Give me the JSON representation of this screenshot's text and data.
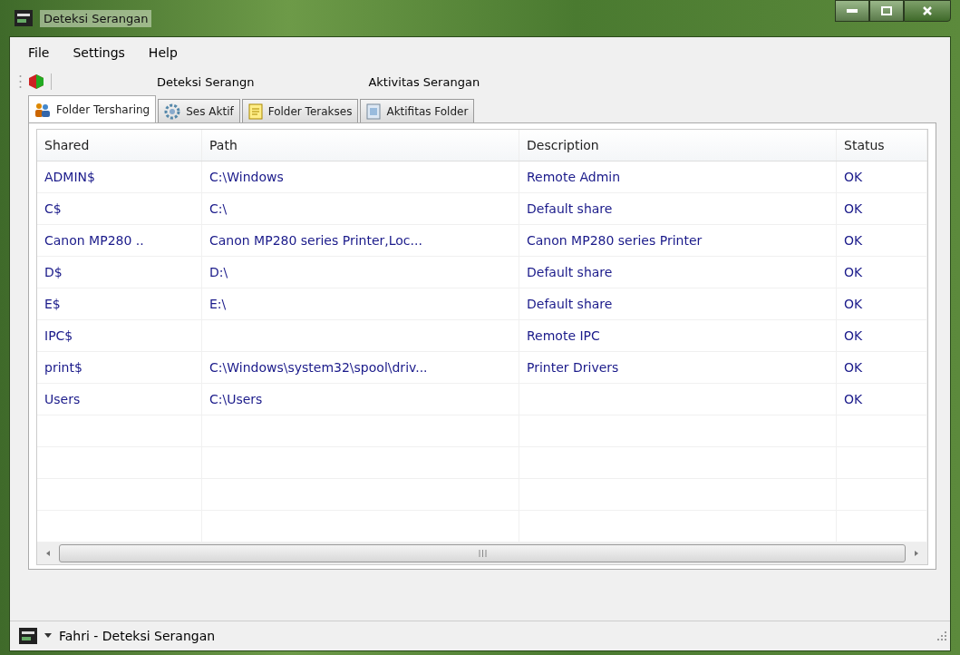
{
  "window": {
    "title": "Deteksi Serangan"
  },
  "menu": [
    "File",
    "Settings",
    "Help"
  ],
  "toolbar": {
    "items": [
      "Deteksi Serangn",
      "Aktivitas Serangan"
    ]
  },
  "tabs": [
    {
      "label": "Folder Tersharing",
      "selected": true
    },
    {
      "label": "Ses Aktif",
      "selected": false
    },
    {
      "label": "Folder Terakses",
      "selected": false
    },
    {
      "label": "Aktifitas Folder",
      "selected": false
    }
  ],
  "table": {
    "columns": [
      "Shared",
      "Path",
      "Description",
      "Status"
    ],
    "rows": [
      [
        "ADMIN$",
        "C:\\Windows",
        "Remote Admin",
        "OK"
      ],
      [
        "C$",
        "C:\\",
        "Default share",
        "OK"
      ],
      [
        "Canon MP280 ..",
        "Canon MP280 series Printer,Loc...",
        "Canon MP280 series Printer",
        "OK"
      ],
      [
        "D$",
        "D:\\",
        "Default share",
        "OK"
      ],
      [
        "E$",
        "E:\\",
        "Default share",
        "OK"
      ],
      [
        "IPC$",
        "",
        "Remote IPC",
        "OK"
      ],
      [
        "print$",
        "C:\\Windows\\system32\\spool\\driv...",
        "Printer Drivers",
        "OK"
      ],
      [
        "Users",
        "C:\\Users",
        "",
        "OK"
      ]
    ]
  },
  "status_bar": {
    "text": "Fahri - Deteksi Serangan"
  }
}
